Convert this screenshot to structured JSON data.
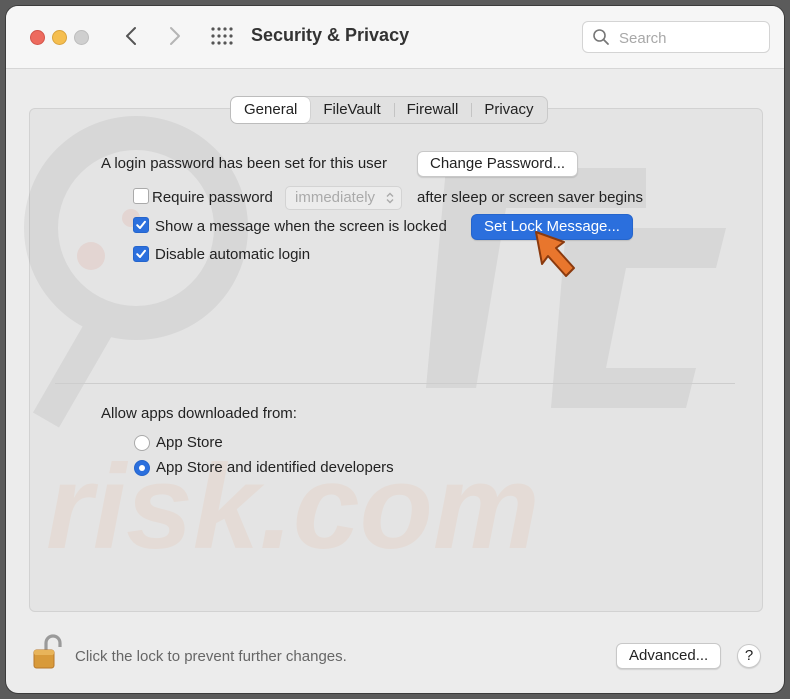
{
  "window": {
    "title": "Security & Privacy",
    "search_placeholder": "Search"
  },
  "tabs": [
    {
      "label": "General",
      "active": true
    },
    {
      "label": "FileVault",
      "active": false
    },
    {
      "label": "Firewall",
      "active": false
    },
    {
      "label": "Privacy",
      "active": false
    }
  ],
  "general": {
    "login_password_text": "A login password has been set for this user",
    "change_password_label": "Change Password...",
    "require_password": {
      "label": "Require password",
      "checked": false,
      "select_value": "immediately",
      "suffix": "after sleep or screen saver begins"
    },
    "show_message": {
      "label": "Show a message when the screen is locked",
      "checked": true,
      "button_label": "Set Lock Message..."
    },
    "disable_autologin": {
      "label": "Disable automatic login",
      "checked": true
    }
  },
  "downloads": {
    "heading": "Allow apps downloaded from:",
    "options": [
      {
        "label": "App Store",
        "selected": false
      },
      {
        "label": "App Store and identified developers",
        "selected": true
      }
    ]
  },
  "footer": {
    "lock_text": "Click the lock to prevent further changes.",
    "advanced_label": "Advanced...",
    "help_label": "?"
  },
  "colors": {
    "accent": "#2b6fdd",
    "pointer_arrow": "#e8762d"
  }
}
